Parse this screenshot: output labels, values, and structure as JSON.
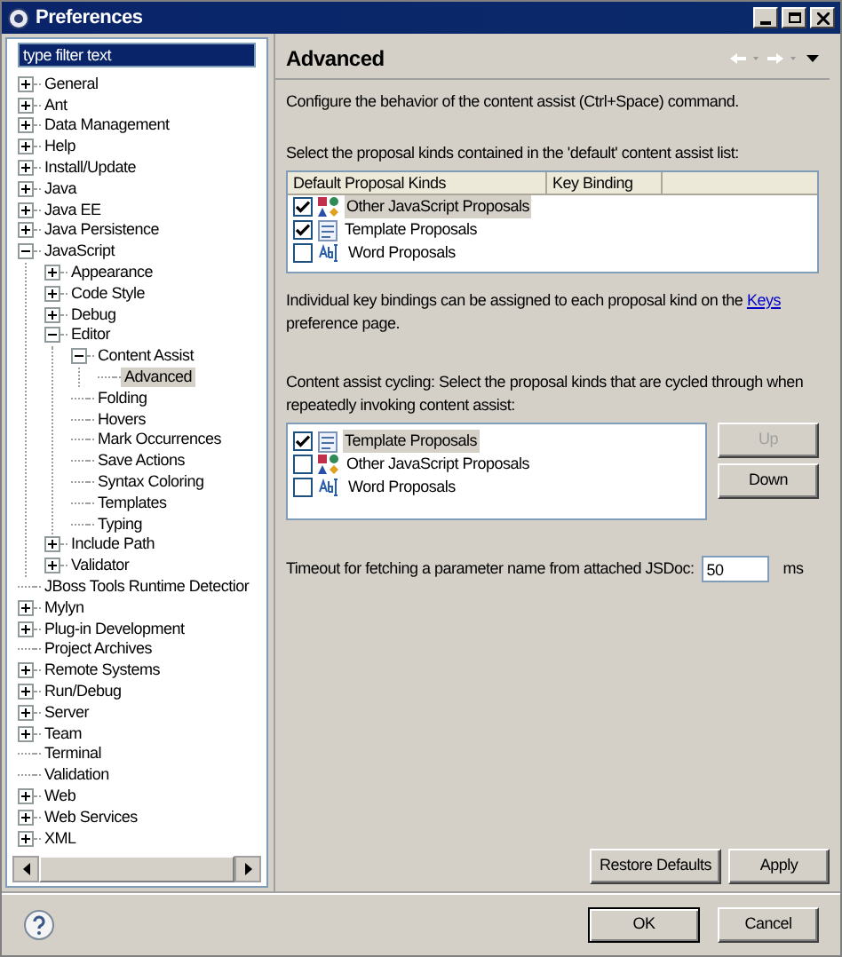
{
  "window": {
    "title": "Preferences"
  },
  "filter": {
    "value": "type filter text"
  },
  "tree": [
    {
      "label": "General",
      "expanded": false,
      "selected": false
    },
    {
      "label": "Ant",
      "expanded": false,
      "selected": false
    },
    {
      "label": "Data Management",
      "expanded": false,
      "selected": false
    },
    {
      "label": "Help",
      "expanded": false,
      "selected": false
    },
    {
      "label": "Install/Update",
      "expanded": false,
      "selected": false
    },
    {
      "label": "Java",
      "expanded": false,
      "selected": false
    },
    {
      "label": "Java EE",
      "expanded": false,
      "selected": false
    },
    {
      "label": "Java Persistence",
      "expanded": false,
      "selected": false
    },
    {
      "label": "JavaScript",
      "expanded": true,
      "selected": false,
      "children": [
        {
          "label": "Appearance",
          "expanded": false,
          "selected": false
        },
        {
          "label": "Code Style",
          "expanded": false,
          "selected": false
        },
        {
          "label": "Debug",
          "expanded": false,
          "selected": false
        },
        {
          "label": "Editor",
          "expanded": true,
          "selected": false,
          "children": [
            {
              "label": "Content Assist",
              "expanded": true,
              "selected": false,
              "children": [
                {
                  "label": "Advanced",
                  "selected": true
                }
              ]
            },
            {
              "label": "Folding",
              "selected": false
            },
            {
              "label": "Hovers",
              "selected": false
            },
            {
              "label": "Mark Occurrences",
              "selected": false
            },
            {
              "label": "Save Actions",
              "selected": false
            },
            {
              "label": "Syntax Coloring",
              "selected": false
            },
            {
              "label": "Templates",
              "selected": false
            },
            {
              "label": "Typing",
              "selected": false
            }
          ]
        },
        {
          "label": "Include Path",
          "expanded": false,
          "selected": false
        },
        {
          "label": "Validator",
          "expanded": false,
          "selected": false
        }
      ]
    },
    {
      "label": "JBoss Tools Runtime Detectior",
      "selected": false
    },
    {
      "label": "Mylyn",
      "expanded": false,
      "selected": false
    },
    {
      "label": "Plug-in Development",
      "expanded": false,
      "selected": false
    },
    {
      "label": "Project Archives",
      "selected": false
    },
    {
      "label": "Remote Systems",
      "expanded": false,
      "selected": false
    },
    {
      "label": "Run/Debug",
      "expanded": false,
      "selected": false
    },
    {
      "label": "Server",
      "expanded": false,
      "selected": false
    },
    {
      "label": "Team",
      "expanded": false,
      "selected": false
    },
    {
      "label": "Terminal",
      "selected": false
    },
    {
      "label": "Validation",
      "selected": false
    },
    {
      "label": "Web",
      "expanded": false,
      "selected": false
    },
    {
      "label": "Web Services",
      "expanded": false,
      "selected": false
    },
    {
      "label": "XML",
      "expanded": false,
      "selected": false
    }
  ],
  "page": {
    "title": "Advanced",
    "description": "Configure the behavior of the content assist (Ctrl+Space) command.",
    "default_list_label": "Select the proposal kinds contained in the 'default' content assist list:",
    "default_table": {
      "columns": [
        "Default Proposal Kinds",
        "Key Binding"
      ],
      "rows": [
        {
          "label": "Other JavaScript Proposals",
          "checked": true,
          "selected": true,
          "kind": "javascript"
        },
        {
          "label": "Template Proposals",
          "checked": true,
          "selected": false,
          "kind": "template"
        },
        {
          "label": "Word Proposals",
          "checked": false,
          "selected": false,
          "kind": "word"
        }
      ]
    },
    "keys_note": {
      "before": "Individual key bindings can be assigned to each proposal kind on the ",
      "link": "Keys",
      "after": " preference page."
    },
    "cycling_label": "Content assist cycling: Select the proposal kinds that are cycled through when repeatedly invoking content assist:",
    "cycling_list": [
      {
        "label": "Template Proposals",
        "checked": true,
        "selected": true,
        "kind": "template"
      },
      {
        "label": "Other JavaScript Proposals",
        "checked": false,
        "selected": false,
        "kind": "javascript"
      },
      {
        "label": "Word Proposals",
        "checked": false,
        "selected": false,
        "kind": "word"
      }
    ],
    "up_button": {
      "label": "Up",
      "disabled": true
    },
    "down_button": {
      "label": "Down",
      "disabled": false
    },
    "timeout": {
      "label": "Timeout for fetching a parameter name from attached JSDoc:",
      "value": "50",
      "unit": "ms"
    },
    "restore_button": "Restore Defaults",
    "apply_button": "Apply"
  },
  "buttons": {
    "ok": "OK",
    "cancel": "Cancel"
  }
}
